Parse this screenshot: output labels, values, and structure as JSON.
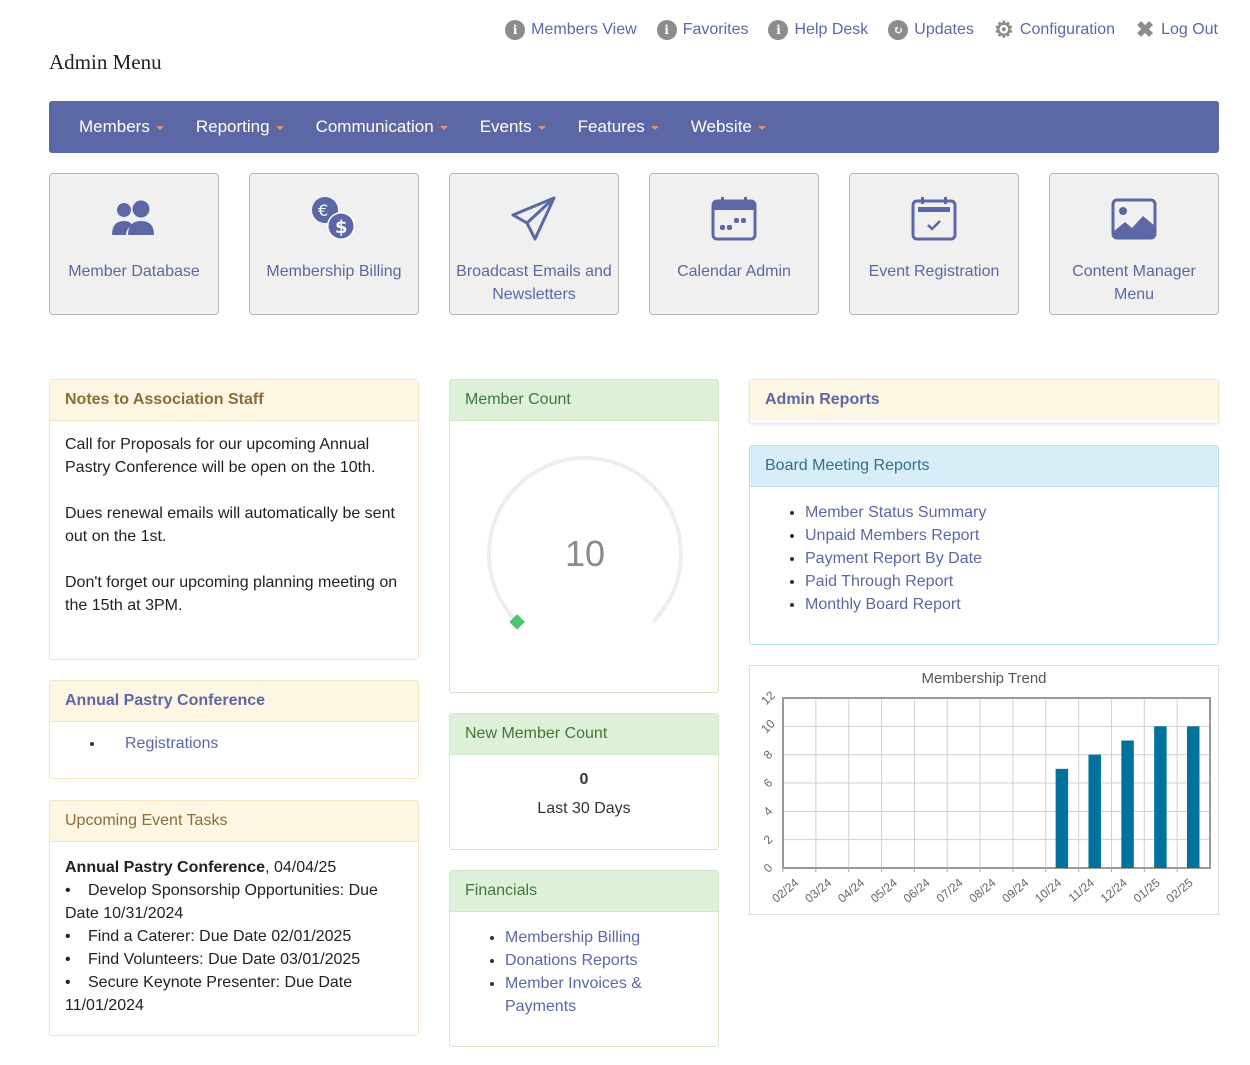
{
  "toplinks": [
    {
      "label": "Members View",
      "icon": "info-icon"
    },
    {
      "label": "Favorites",
      "icon": "info-icon"
    },
    {
      "label": "Help Desk",
      "icon": "info-icon"
    },
    {
      "label": "Updates",
      "icon": "refresh-icon"
    },
    {
      "label": "Configuration",
      "icon": "gear-icon"
    },
    {
      "label": "Log Out",
      "icon": "close-icon"
    }
  ],
  "page_title": "Admin Menu",
  "nav": [
    "Members",
    "Reporting",
    "Communication",
    "Events",
    "Features",
    "Website"
  ],
  "tiles": [
    {
      "label": "Member Database",
      "icon": "users-icon"
    },
    {
      "label": "Membership Billing",
      "icon": "coins-icon"
    },
    {
      "label": "Broadcast Emails and Newsletters",
      "icon": "paper-plane-icon"
    },
    {
      "label": "Calendar Admin",
      "icon": "calendar-icon"
    },
    {
      "label": "Event Registration",
      "icon": "calendar-check-icon"
    },
    {
      "label": "Content Manager Menu",
      "icon": "image-icon"
    }
  ],
  "notes": {
    "title": "Notes to Association Staff",
    "paragraphs": [
      "Call for Proposals for our upcoming Annual Pastry Conference will be open on the 10th.",
      "Dues renewal emails will automatically be sent out on the 1st.",
      "Don't forget our upcoming planning meeting on the 15th at 3PM."
    ]
  },
  "conference": {
    "title": "Annual Pastry Conference",
    "links": [
      "Registrations"
    ]
  },
  "tasks": {
    "title": "Upcoming Event Tasks",
    "event_name": "Annual Pastry Conference",
    "event_date": ", 04/04/25",
    "items": [
      "Develop Sponsorship Opportunities: Due Date 10/31/2024",
      "Find a Caterer: Due Date 02/01/2025",
      "Find Volunteers: Due Date 03/01/2025",
      "Secure Keynote Presenter: Due Date 11/01/2024"
    ]
  },
  "member_count": {
    "title": "Member Count",
    "value": "10",
    "gauge_fraction": 0.0
  },
  "new_member_count": {
    "title": "New Member Count",
    "value": "0",
    "caption": "Last 30 Days"
  },
  "financials": {
    "title": "Financials",
    "links": [
      "Membership Billing",
      "Donations Reports",
      "Member Invoices & Payments"
    ]
  },
  "admin_reports": {
    "title": "Admin Reports"
  },
  "board_reports": {
    "title": "Board Meeting Reports",
    "links": [
      "Member Status Summary",
      "Unpaid Members Report",
      "Payment Report By Date",
      "Paid Through Report",
      "Monthly Board Report"
    ]
  },
  "colors": {
    "brand": "#5b68a5",
    "bar": "#00729c",
    "gauge": "#4cc472"
  },
  "chart_data": {
    "type": "bar",
    "title": "Membership Trend",
    "categories": [
      "02/24",
      "03/24",
      "04/24",
      "05/24",
      "06/24",
      "07/24",
      "08/24",
      "09/24",
      "10/24",
      "11/24",
      "12/24",
      "01/25",
      "02/25"
    ],
    "values": [
      0,
      0,
      0,
      0,
      0,
      0,
      0,
      0,
      7,
      8,
      9,
      10,
      10
    ],
    "xlabel": "",
    "ylabel": "",
    "ylim": [
      0,
      12
    ],
    "yticks": [
      0,
      2,
      4,
      6,
      8,
      10,
      12
    ],
    "grid": true,
    "legend": "none"
  }
}
